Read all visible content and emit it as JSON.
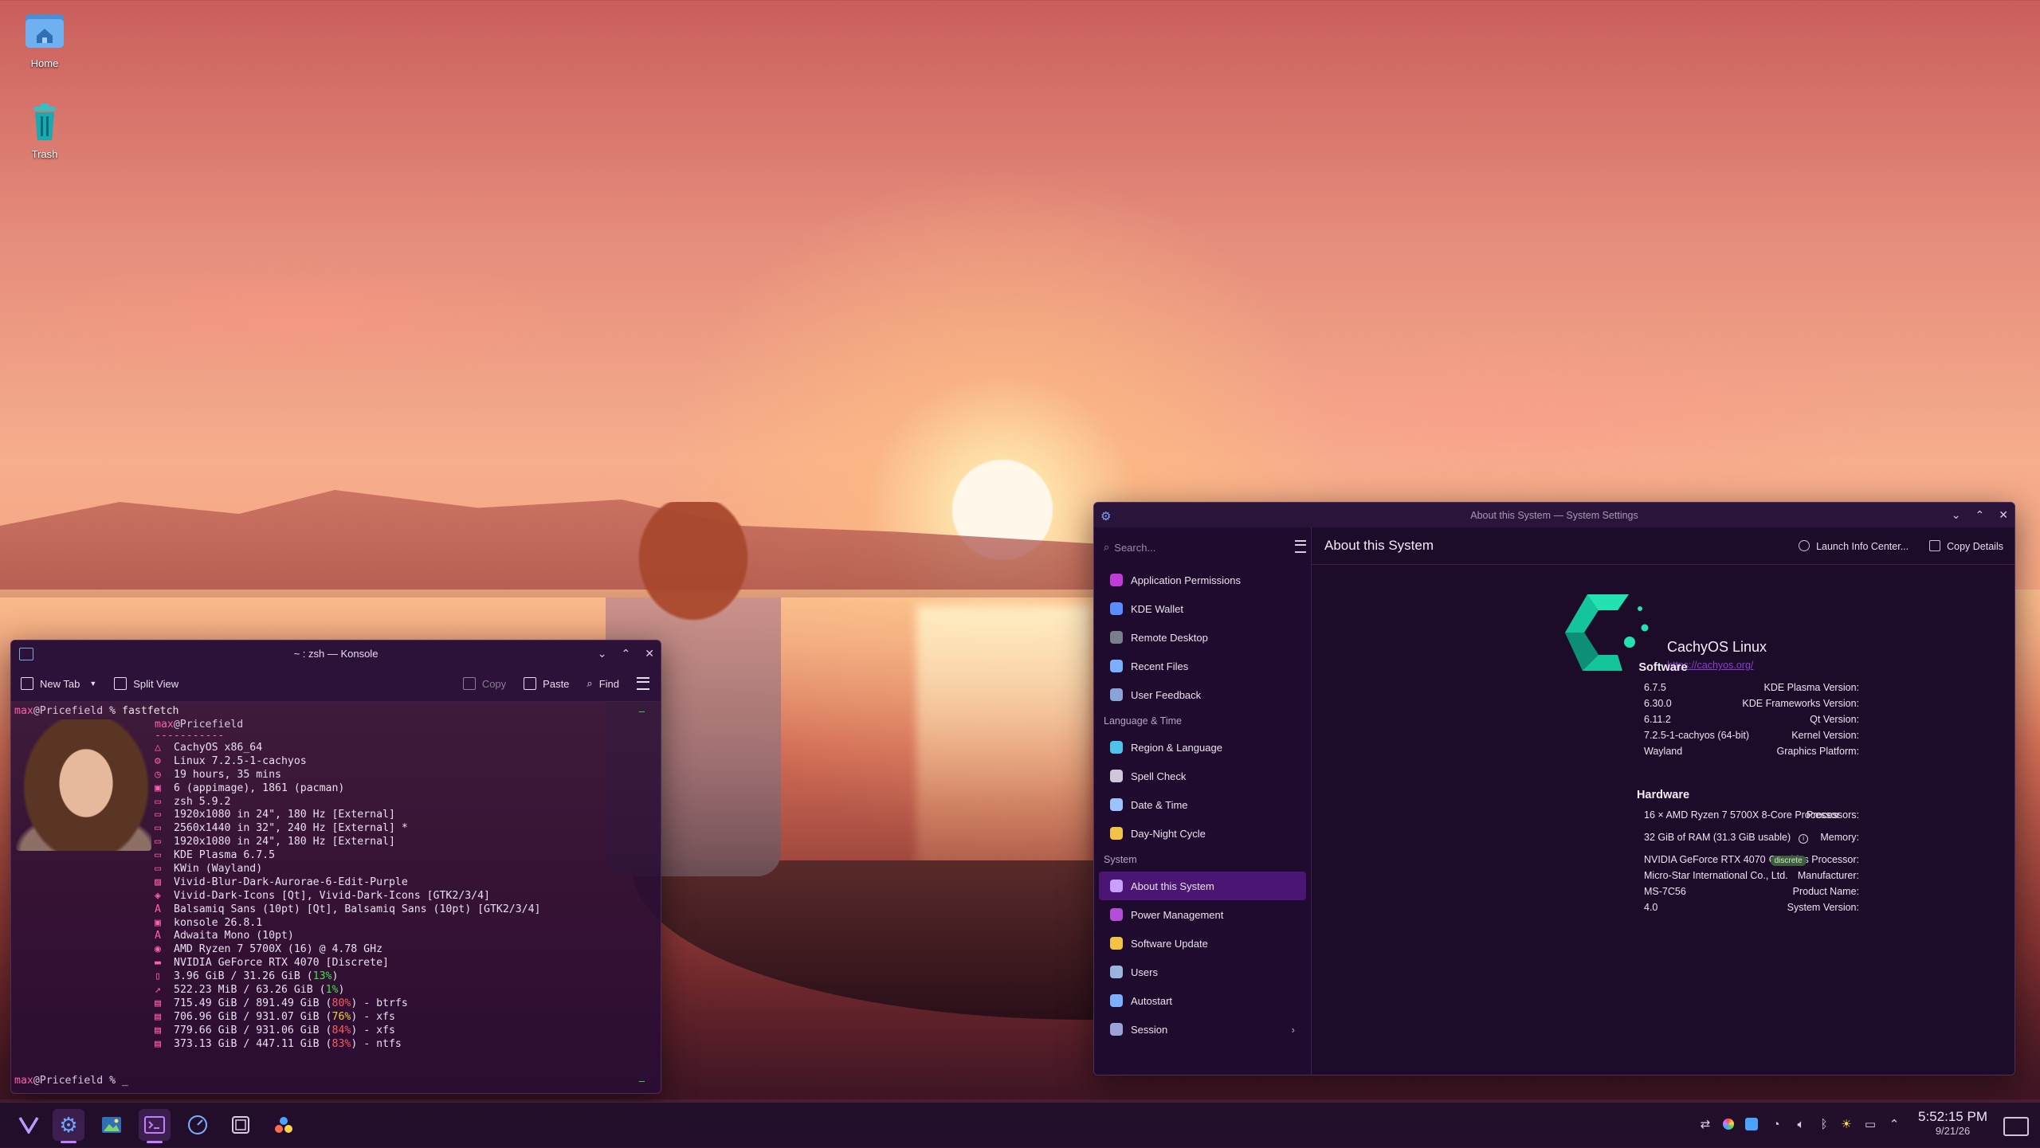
{
  "desktop": {
    "icons": [
      {
        "label": "Home"
      },
      {
        "label": "Trash"
      }
    ]
  },
  "konsole": {
    "title": "~ : zsh — Konsole",
    "toolbar": {
      "new_tab": "New Tab",
      "split_view": "Split View",
      "copy": "Copy",
      "paste": "Paste",
      "find": "Find"
    },
    "prompt_user": "max",
    "prompt_host": "@Pricefield",
    "prompt_suffix": " % ",
    "command": "fastfetch",
    "ff_header_user": "max",
    "ff_header_host": "@Pricefield",
    "ff_separator": "-----------",
    "lines": [
      {
        "icon": "△",
        "text": "CachyOS x86_64"
      },
      {
        "icon": "⚙",
        "text": "Linux 7.2.5-1-cachyos"
      },
      {
        "icon": "◷",
        "text": "19 hours, 35 mins"
      },
      {
        "icon": "▣",
        "text": "6 (appimage), 1861 (pacman)"
      },
      {
        "icon": "▭",
        "text": "zsh 5.9.2"
      },
      {
        "icon": "▭",
        "text": "1920x1080 in 24\", 180 Hz [External]"
      },
      {
        "icon": "▭",
        "text": "2560x1440 in 32\", 240 Hz [External] *"
      },
      {
        "icon": "▭",
        "text": "1920x1080 in 24\", 180 Hz [External]"
      },
      {
        "icon": "▭",
        "text": "KDE Plasma 6.7.5"
      },
      {
        "icon": "▭",
        "text": "KWin (Wayland)"
      },
      {
        "icon": "▨",
        "text": "Vivid-Blur-Dark-Aurorae-6-Edit-Purple"
      },
      {
        "icon": "◈",
        "text": "Vivid-Dark-Icons [Qt], Vivid-Dark-Icons [GTK2/3/4]"
      },
      {
        "icon": "A",
        "text": "Balsamiq Sans (10pt) [Qt], Balsamiq Sans (10pt) [GTK2/3/4]"
      },
      {
        "icon": "▣",
        "text": "konsole 26.8.1"
      },
      {
        "icon": "A",
        "text": "Adwaita Mono (10pt)"
      },
      {
        "icon": "◉",
        "text": "AMD Ryzen 7 5700X (16) @ 4.78 GHz"
      },
      {
        "icon": "▬",
        "text": "NVIDIA GeForce RTX 4070 [Discrete]"
      },
      {
        "icon": "▯",
        "pre": "3.96 GiB / 31.26 GiB (",
        "pct": "13%",
        "pct_class": "pct-green",
        "post": ")"
      },
      {
        "icon": "↗",
        "pre": "522.23 MiB / 63.26 GiB (",
        "pct": "1%",
        "pct_class": "pct-green",
        "post": ")"
      },
      {
        "icon": "▤",
        "pre": "715.49 GiB / 891.49 GiB (",
        "pct": "80%",
        "pct_class": "pct-red",
        "post": ") - btrfs"
      },
      {
        "icon": "▤",
        "pre": "706.96 GiB / 931.07 GiB (",
        "pct": "76%",
        "pct_class": "pct-yellow",
        "post": ") - xfs"
      },
      {
        "icon": "▤",
        "pre": "779.66 GiB / 931.06 GiB (",
        "pct": "84%",
        "pct_class": "pct-red",
        "post": ") - xfs"
      },
      {
        "icon": "▤",
        "pre": "373.13 GiB / 447.11 GiB (",
        "pct": "83%",
        "pct_class": "pct-red",
        "post": ") - ntfs"
      }
    ],
    "prompt_cursor": "_"
  },
  "settings": {
    "title": "About this System — System Settings",
    "search_placeholder": "Search...",
    "sidebar": [
      {
        "type": "item",
        "label": "Application Permissions",
        "color": "#c13bd8",
        "name": "sidebar-item-application-permissions"
      },
      {
        "type": "item",
        "label": "KDE Wallet",
        "color": "#5b8dff",
        "name": "sidebar-item-kde-wallet"
      },
      {
        "type": "item",
        "label": "Remote Desktop",
        "color": "#7a7f8c",
        "name": "sidebar-item-remote-desktop"
      },
      {
        "type": "item",
        "label": "Recent Files",
        "color": "#7ab0ff",
        "name": "sidebar-item-recent-files"
      },
      {
        "type": "item",
        "label": "User Feedback",
        "color": "#8aa4d8",
        "name": "sidebar-item-user-feedback"
      },
      {
        "type": "category",
        "label": "Language & Time"
      },
      {
        "type": "item",
        "label": "Region & Language",
        "color": "#4ec2e8",
        "name": "sidebar-item-region-language"
      },
      {
        "type": "item",
        "label": "Spell Check",
        "color": "#cfc6d8",
        "name": "sidebar-item-spell-check"
      },
      {
        "type": "item",
        "label": "Date & Time",
        "color": "#9cc3ff",
        "name": "sidebar-item-date-time"
      },
      {
        "type": "item",
        "label": "Day-Night Cycle",
        "color": "#f3c443",
        "name": "sidebar-item-day-night-cycle"
      },
      {
        "type": "category",
        "label": "System"
      },
      {
        "type": "item",
        "label": "About this System",
        "color": "#c8a0ff",
        "active": true,
        "name": "sidebar-item-about-this-system"
      },
      {
        "type": "item",
        "label": "Power Management",
        "color": "#b14fd8",
        "name": "sidebar-item-power-management"
      },
      {
        "type": "item",
        "label": "Software Update",
        "color": "#f3c443",
        "name": "sidebar-item-software-update"
      },
      {
        "type": "item",
        "label": "Users",
        "color": "#9ab4e0",
        "name": "sidebar-item-users"
      },
      {
        "type": "item",
        "label": "Autostart",
        "color": "#7ab0ff",
        "name": "sidebar-item-autostart"
      },
      {
        "type": "item",
        "label": "Session",
        "color": "#9aa4d8",
        "chevron": "›",
        "name": "sidebar-item-session"
      }
    ],
    "header": {
      "title": "About this System",
      "launch_info": "Launch Info Center...",
      "copy_details": "Copy Details"
    },
    "os_name": "CachyOS Linux",
    "os_url": "https://cachyos.org/",
    "software_title": "Software",
    "software": [
      {
        "k": "KDE Plasma Version:",
        "v": "6.7.5"
      },
      {
        "k": "KDE Frameworks Version:",
        "v": "6.30.0"
      },
      {
        "k": "Qt Version:",
        "v": "6.11.2"
      },
      {
        "k": "Kernel Version:",
        "v": "7.2.5-1-cachyos (64-bit)"
      },
      {
        "k": "Graphics Platform:",
        "v": "Wayland"
      }
    ],
    "hardware_title": "Hardware",
    "hardware": [
      {
        "k": "Processors:",
        "v": "16 × AMD Ryzen 7 5700X 8-Core Processor"
      },
      {
        "k": "Memory:",
        "v": "32 GiB of RAM (31.3 GiB usable)",
        "info": "i"
      },
      {
        "k": "Graphics Processor:",
        "v": "NVIDIA GeForce RTX 4070",
        "badge": "discrete"
      },
      {
        "k": "Manufacturer:",
        "v": "Micro-Star International Co., Ltd."
      },
      {
        "k": "Product Name:",
        "v": "MS-7C56"
      },
      {
        "k": "System Version:",
        "v": "4.0"
      }
    ]
  },
  "taskbar": {
    "time": "5:52:15 PM",
    "date": "9/21/26"
  },
  "colors": {
    "accent": "#4b1673",
    "prompt_pink": "#ff5fb0",
    "cachy_green": "#18d4a0"
  }
}
